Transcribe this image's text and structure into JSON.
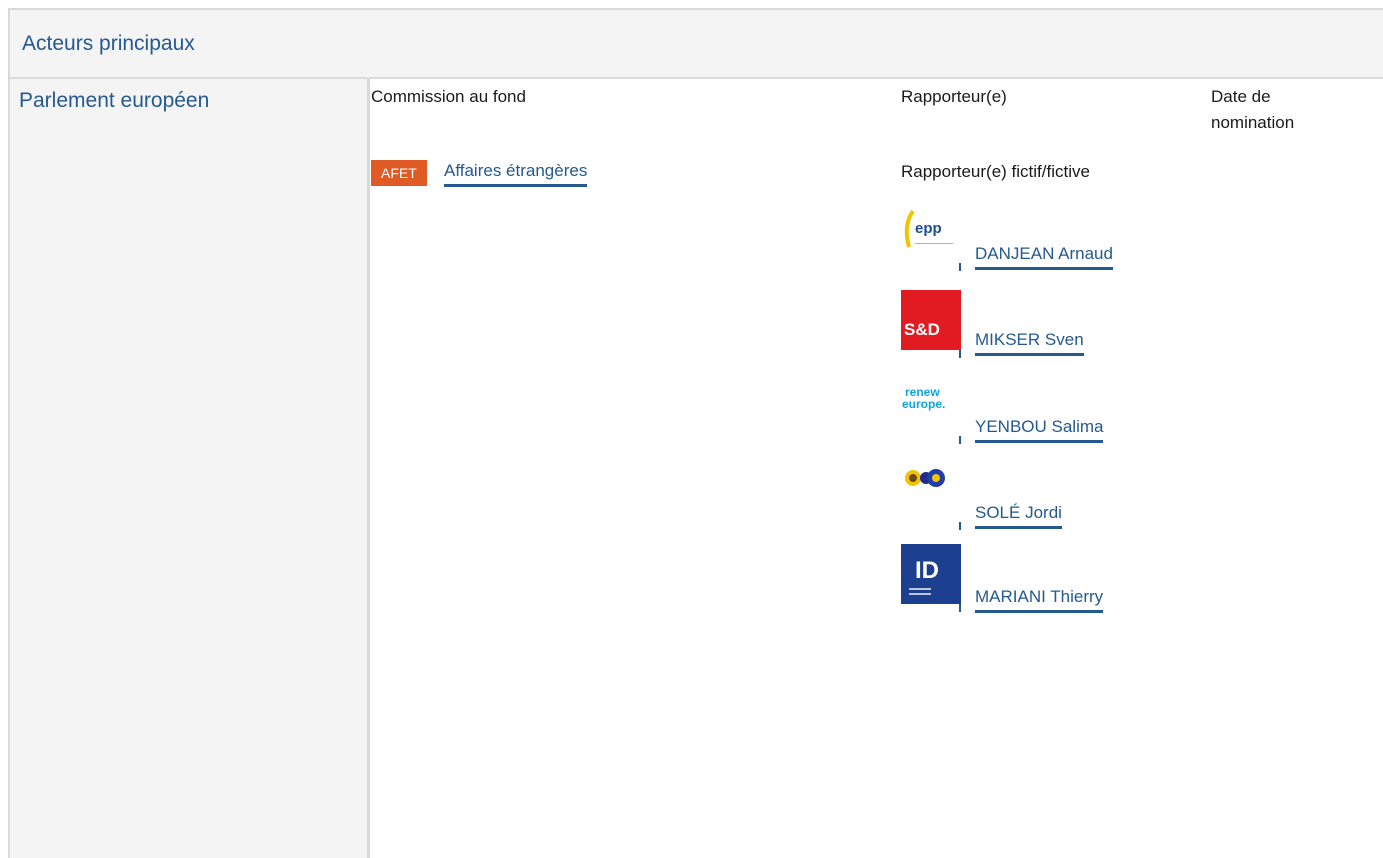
{
  "section": {
    "title": "Acteurs principaux"
  },
  "institution": {
    "name": "Parlement européen"
  },
  "columns": {
    "committee": "Commission au fond",
    "rapporteur": "Rapporteur(e)",
    "date_line1": "Date de",
    "date_line2": "nomination"
  },
  "committee": {
    "code": "AFET",
    "name": "Affaires étrangères",
    "badge_color": "#e05a26"
  },
  "shadow_label": "Rapporteur(e) fictif/fictive",
  "shadows": [
    {
      "name": "DANJEAN Arnaud",
      "group_logo": "epp-logo",
      "logo_text": "epp"
    },
    {
      "name": "MIKSER Sven",
      "group_logo": "sd-logo",
      "logo_text": "S&D"
    },
    {
      "name": "YENBOU Salima",
      "group_logo": "renew-europe-logo",
      "logo_line1": "renew",
      "logo_line2": "europe."
    },
    {
      "name": "SOLÉ Jordi",
      "group_logo": "greens-efa-logo"
    },
    {
      "name": "MARIANI Thierry",
      "group_logo": "id-logo",
      "logo_text": "ID"
    }
  ],
  "colors": {
    "link": "#25598f",
    "header_bg": "#f4f4f4"
  }
}
